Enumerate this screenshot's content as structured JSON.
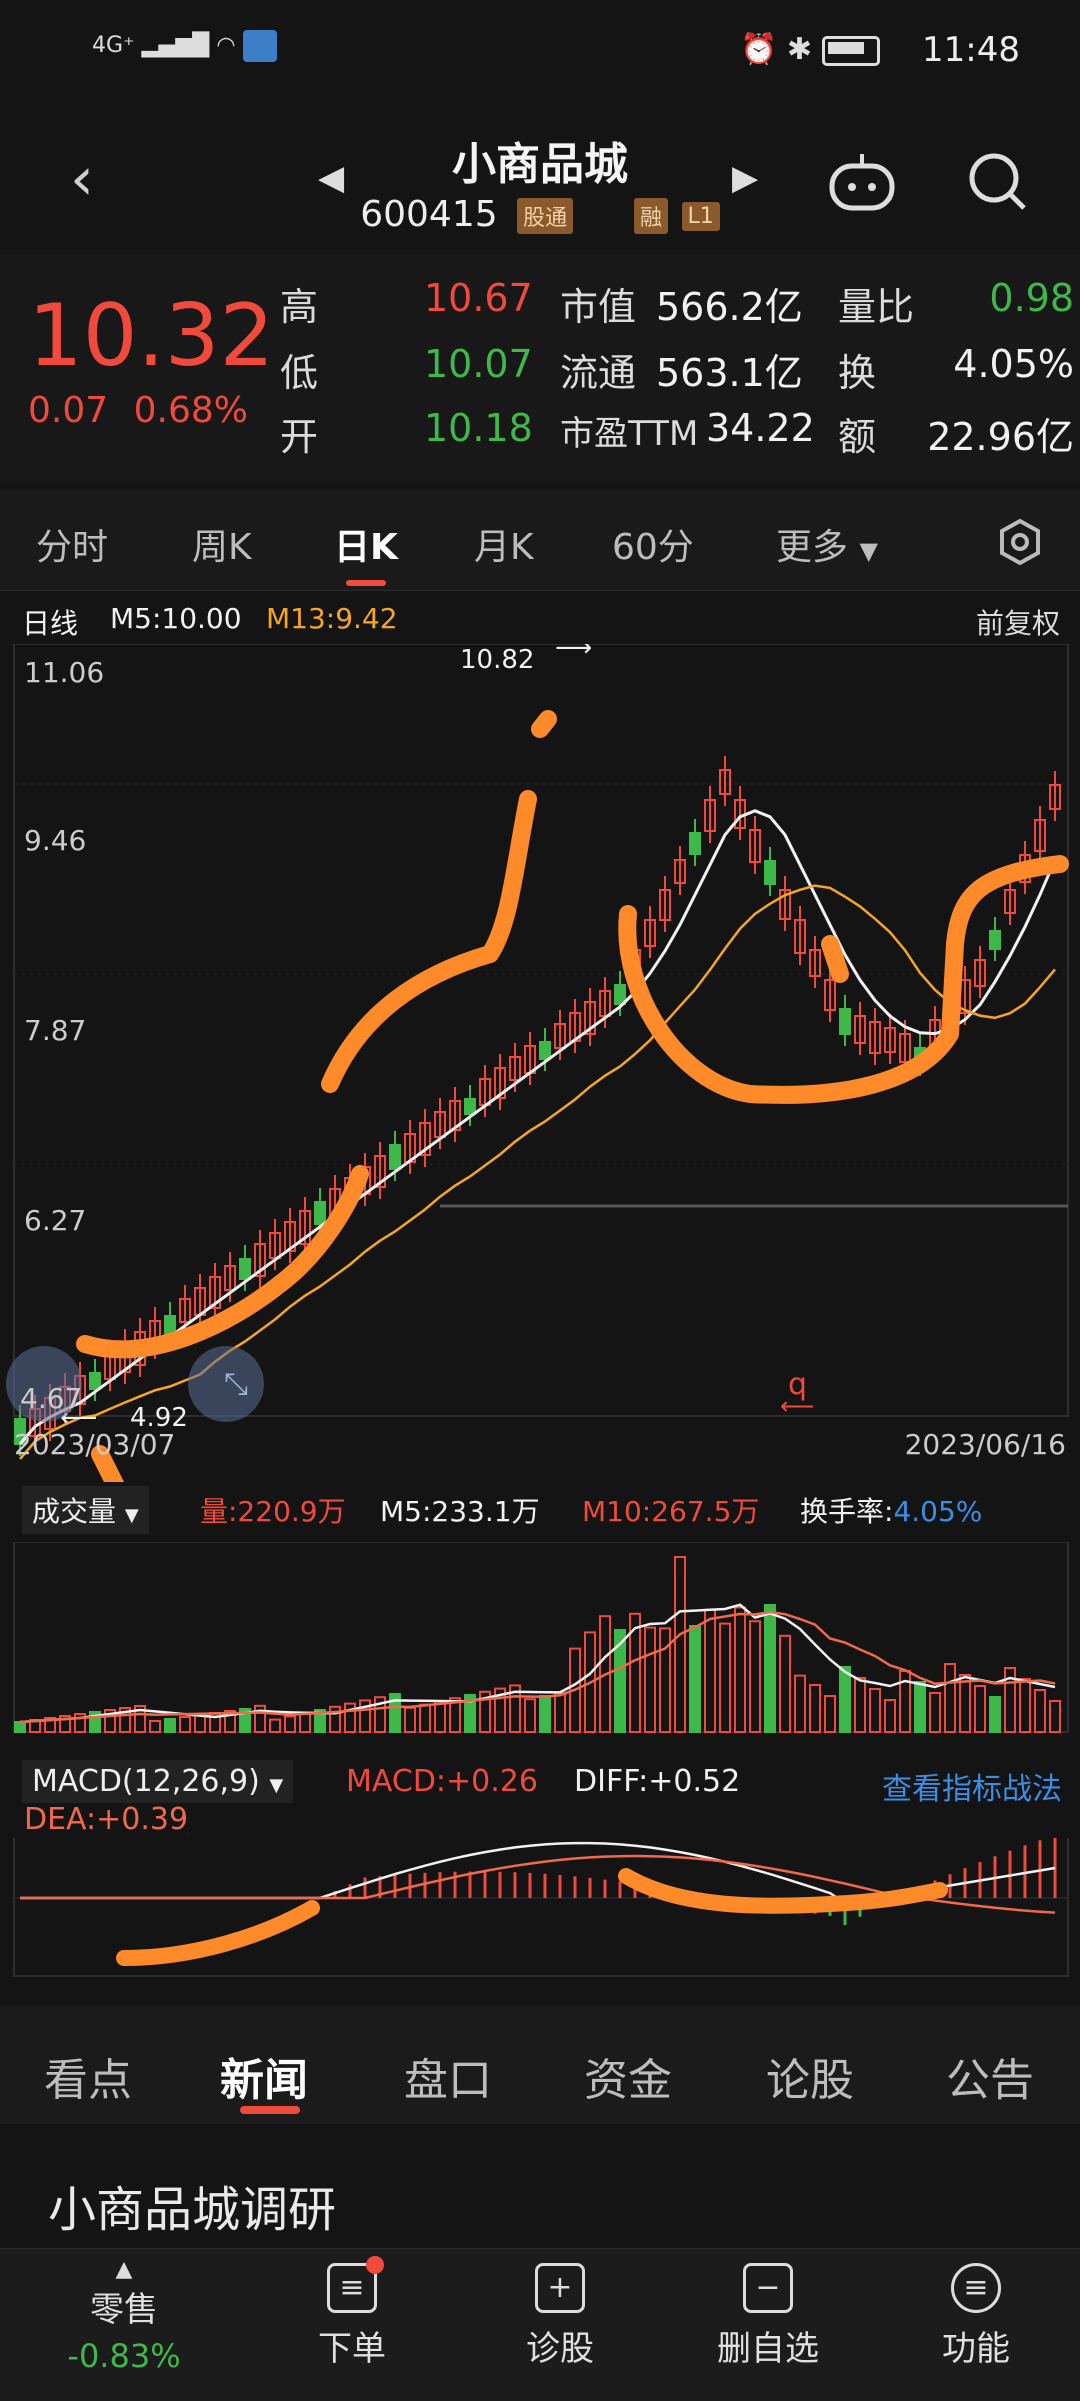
{
  "status_bar": {
    "network": "4G⁺",
    "time": "11:48"
  },
  "header": {
    "stock_name": "小商品城",
    "stock_code": "600415",
    "tags": [
      "股通",
      "融",
      "L1"
    ]
  },
  "quote": {
    "price": "10.32",
    "change": "0.07",
    "change_pct": "0.68%",
    "high_label": "高",
    "high": "10.67",
    "low_label": "低",
    "low": "10.07",
    "open_label": "开",
    "open": "10.18",
    "mcap_label": "市值",
    "mcap": "566.2亿",
    "float_label": "流通",
    "float": "563.1亿",
    "pe_label": "市盈TTM",
    "pe": "34.22",
    "vol_ratio_label": "量比",
    "vol_ratio": "0.98",
    "turnover_label": "换",
    "turnover": "4.05%",
    "amount_label": "额",
    "amount": "22.96亿"
  },
  "period_tabs": [
    "分时",
    "周K",
    "日K",
    "月K",
    "60分",
    "更多"
  ],
  "active_period": "日K",
  "kline": {
    "label": "日线",
    "ma5": "M5:10.00",
    "ma13": "M13:9.42",
    "adjust": "前复权",
    "y_labels": [
      "11.06",
      "9.46",
      "7.87",
      "6.27"
    ],
    "high_marker": "10.82",
    "low_marker": "4.92",
    "left_price": "4.67",
    "date_start": "2023/03/07",
    "date_end": "2023/06/16",
    "annotation": "q"
  },
  "volume": {
    "selector": "成交量",
    "vol": "量:220.9万",
    "m5": "M5:233.1万",
    "m10": "M10:267.5万",
    "turnover_label": "换手率:",
    "turnover": "4.05%"
  },
  "macd": {
    "selector": "MACD(12,26,9)",
    "macd": "MACD:+0.26",
    "diff": "DIFF:+0.52",
    "dea": "DEA:+0.39",
    "link": "查看指标战法"
  },
  "news_tabs": [
    "看点",
    "新闻",
    "盘口",
    "资金",
    "论股",
    "公告"
  ],
  "active_news_tab": "新闻",
  "headline": "小商品城调研",
  "bottom_nav": {
    "index_name": "零售",
    "index_change": "-0.83%",
    "items": [
      "下单",
      "诊股",
      "删自选",
      "功能"
    ]
  },
  "colors": {
    "up": "#f04a3c",
    "down": "#3fb84a",
    "ma13": "#f5a623",
    "highlight": "#ff8a2a",
    "link": "#3a8ee6"
  }
}
